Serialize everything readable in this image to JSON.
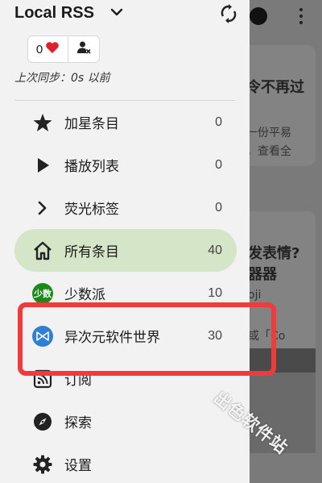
{
  "drawer": {
    "title": "Local RSS",
    "likes_count": "0",
    "sync_status": "上次同步：0s 以前",
    "items": [
      {
        "label": "加星条目",
        "count": "0",
        "icon": "star-icon"
      },
      {
        "label": "播放列表",
        "count": "0",
        "icon": "play-icon"
      },
      {
        "label": "荧光标签",
        "count": "0",
        "icon": "chevron-right-icon"
      },
      {
        "label": "所有条目",
        "count": "40",
        "icon": "home-icon",
        "active": true
      },
      {
        "label": "少数派",
        "count": "10",
        "icon": "sspai-logo-icon",
        "badge": "少数"
      },
      {
        "label": "异次元软件世界",
        "count": "30",
        "icon": "iplaysoft-logo-icon"
      },
      {
        "label": "订阅",
        "icon": "rss-feed-icon"
      },
      {
        "label": "探索",
        "icon": "compass-icon"
      },
      {
        "label": "设置",
        "icon": "gear-icon"
      }
    ]
  },
  "background": {
    "card1_line1": "令不再过",
    "card1_line2": "一份平易",
    "card1_line3": "，查看全",
    "card2_line1": "发表情?",
    "card2_line2": "器器",
    "card2_line3": "oji",
    "card2_line4": "或「Co"
  },
  "watermark": "出色软件站",
  "colors": {
    "drawer_bg": "#f2f2f2",
    "active_item_bg": "#d5e5c8",
    "highlight_border": "#ef3b3b",
    "heart": "#e0202a",
    "sspai_badge": "#1a8a1a",
    "iplaysoft_badge": "#2f7fd6"
  }
}
